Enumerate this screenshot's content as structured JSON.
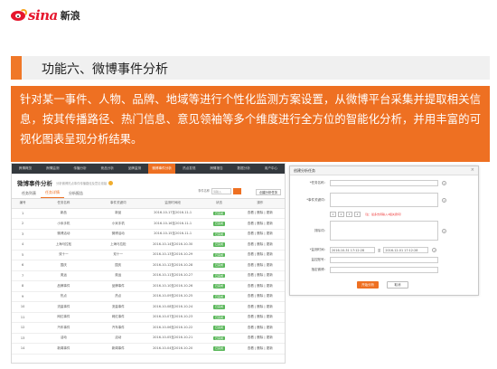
{
  "logo": {
    "text": "sina",
    "cn": "新浪",
    "brand_color": "#e6162d"
  },
  "section": {
    "title": "功能六、微博事件分析",
    "accent": "#f07828"
  },
  "description": "针对某一事件、人物、品牌、地域等进行个性化监测方案设置，从微博平台采集并提取相关信息，按其传播路径、热门信息、意见领袖等多个维度进行全方位的智能化分析，并用丰富的可视化图表呈现分析结果。",
  "app": {
    "nav": [
      "舆情概览",
      "舆情监测",
      "传播分析",
      "竞品分析",
      "品牌监测",
      "微博事件分析",
      "热点发现",
      "舆情报告",
      "数据分析",
      "用户中心"
    ],
    "nav_active_index": 5,
    "title": "微博事件分析",
    "subtitle": "分析微博热点事件传播路径及意见领袖",
    "tabs": [
      "任务列表",
      "任务详情",
      "分析报告"
    ],
    "active_tab": 1,
    "filter_label": "事件名称",
    "filter_placeholder": "请输入",
    "new_button": "创建分析任务",
    "columns": [
      "编号",
      "任务名称",
      "事件关键词",
      "监测时间段",
      "状态",
      "操作"
    ],
    "status_text": "已完成",
    "ops_text": "查看 | 删除 | 更新",
    "rows": [
      {
        "id": "1",
        "name": "新品",
        "kw": "新品",
        "time": "2016-10-17至2016-11-1"
      },
      {
        "id": "2",
        "name": "小米手机",
        "kw": "小米手机",
        "time": "2016-10-16至2016-11-1"
      },
      {
        "id": "3",
        "name": "微博活动",
        "kw": "微博活动",
        "time": "2016-10-15至2016-11-1"
      },
      {
        "id": "4",
        "name": "上海马拉松",
        "kw": "上海马拉松",
        "time": "2016-10-14至2016-10-30"
      },
      {
        "id": "5",
        "name": "双十一",
        "kw": "双十一",
        "time": "2016-10-13至2016-10-29"
      },
      {
        "id": "6",
        "name": "国庆",
        "kw": "国庆",
        "time": "2016-10-12至2016-10-28"
      },
      {
        "id": "7",
        "name": "奥运",
        "kw": "奥运",
        "time": "2016-10-11至2016-10-27"
      },
      {
        "id": "8",
        "name": "品牌事件",
        "kw": "品牌事件",
        "time": "2016-10-10至2016-10-26"
      },
      {
        "id": "9",
        "name": "热点",
        "kw": "热点",
        "time": "2016-10-09至2016-10-25"
      },
      {
        "id": "10",
        "name": "流量事件",
        "kw": "流量事件",
        "time": "2016-10-08至2016-10-24"
      },
      {
        "id": "11",
        "name": "网红事件",
        "kw": "网红事件",
        "time": "2016-10-07至2016-10-23"
      },
      {
        "id": "12",
        "name": "汽车事件",
        "kw": "汽车事件",
        "time": "2016-10-06至2016-10-22"
      },
      {
        "id": "13",
        "name": "活动",
        "kw": "活动",
        "time": "2016-10-05至2016-10-21"
      },
      {
        "id": "14",
        "name": "新闻事件",
        "kw": "新闻事件",
        "time": "2016-10-04至2016-10-20"
      }
    ]
  },
  "dialog": {
    "title": "创建分析任务",
    "labels": {
      "name": "*任务名称：",
      "keyword": "*事件关键词：",
      "exclude": "排除词：",
      "time": "*监测时间：",
      "accounts": "监控账号：",
      "accounts2": "指定微博："
    },
    "placeholders": {
      "name": "请输入任务名称",
      "keyword": "请输入事件关键词",
      "exclude": "请输入排除词",
      "accounts": "请输入监控账号"
    },
    "segments": [
      "1",
      "2",
      "3",
      "4"
    ],
    "hint": "（注：最多支持输入4组关键词）",
    "date_start": "2016-10-31 17:12:28",
    "date_sep": "至",
    "date_end": "2016-12-01 17:12:28",
    "confirm": "开始分析",
    "cancel": "取消"
  }
}
